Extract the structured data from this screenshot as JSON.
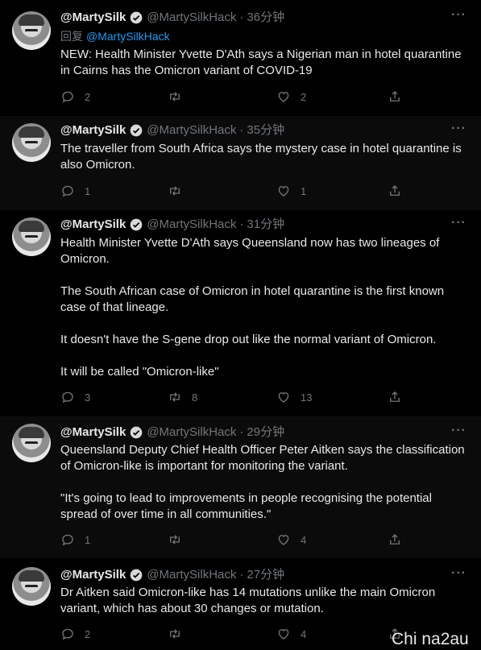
{
  "author": {
    "name": "@MartySilk",
    "handle": "@MartySilkHack"
  },
  "reply_prefix": "回复",
  "reply_handle": "@MartySilkHack",
  "tweets": [
    {
      "time": "36分钟",
      "paragraphs": [
        "NEW: Health Minister Yvette D'Ath says a Nigerian man in hotel quarantine in Cairns has the Omicron variant of COVID-19"
      ],
      "replies": "2",
      "retweets": "",
      "likes": "2"
    },
    {
      "time": "35分钟",
      "paragraphs": [
        "The traveller from South Africa says the mystery case in hotel quarantine is also Omicron."
      ],
      "replies": "1",
      "retweets": "",
      "likes": "1"
    },
    {
      "time": "31分钟",
      "paragraphs": [
        "Health Minister Yvette D'Ath says Queensland now has two lineages of Omicron.",
        "The South African case of Omicron in hotel quarantine is the first known case of that lineage.",
        "It doesn't have the S-gene drop out like the normal variant of Omicron.",
        "It will be called \"Omicron-like\""
      ],
      "replies": "3",
      "retweets": "8",
      "likes": "13"
    },
    {
      "time": "29分钟",
      "paragraphs": [
        "Queensland Deputy Chief Health Officer Peter Aitken says the classification of Omicron-like is important for monitoring the variant.",
        "\"It's going to lead to improvements in people recognising the potential spread of over time in all communities.\""
      ],
      "replies": "1",
      "retweets": "",
      "likes": "4"
    },
    {
      "time": "27分钟",
      "paragraphs": [
        "Dr Aitken said Omicron-like has 14 mutations unlike the main Omicron variant, which has about 30 changes or mutation."
      ],
      "replies": "2",
      "retweets": "",
      "likes": "4"
    }
  ],
  "icons": {
    "reply": "reply-icon",
    "retweet": "retweet-icon",
    "like": "heart-icon",
    "share": "share-icon",
    "more": "more-icon",
    "verified": "verified-badge-icon"
  },
  "colors": {
    "background": "#000000",
    "alt_background": "#0b0b0b",
    "link": "#1d9bf0",
    "muted": "#71767b",
    "text": "#e7e9ea"
  },
  "watermark": "Chi na2au"
}
